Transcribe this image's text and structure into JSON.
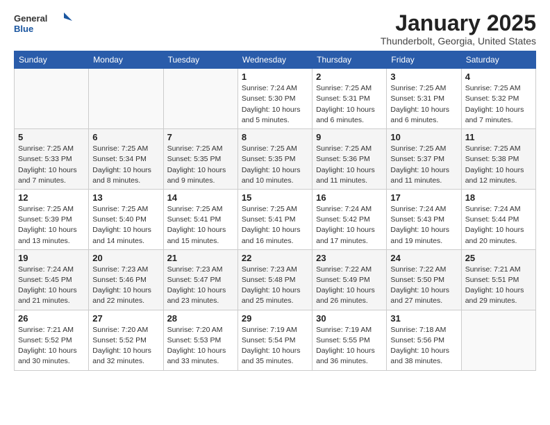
{
  "header": {
    "logo_general": "General",
    "logo_blue": "Blue",
    "month_title": "January 2025",
    "subtitle": "Thunderbolt, Georgia, United States"
  },
  "weekdays": [
    "Sunday",
    "Monday",
    "Tuesday",
    "Wednesday",
    "Thursday",
    "Friday",
    "Saturday"
  ],
  "weeks": [
    [
      {
        "day": "",
        "sunrise": "",
        "sunset": "",
        "daylight": ""
      },
      {
        "day": "",
        "sunrise": "",
        "sunset": "",
        "daylight": ""
      },
      {
        "day": "",
        "sunrise": "",
        "sunset": "",
        "daylight": ""
      },
      {
        "day": "1",
        "sunrise": "Sunrise: 7:24 AM",
        "sunset": "Sunset: 5:30 PM",
        "daylight": "Daylight: 10 hours and 5 minutes."
      },
      {
        "day": "2",
        "sunrise": "Sunrise: 7:25 AM",
        "sunset": "Sunset: 5:31 PM",
        "daylight": "Daylight: 10 hours and 6 minutes."
      },
      {
        "day": "3",
        "sunrise": "Sunrise: 7:25 AM",
        "sunset": "Sunset: 5:31 PM",
        "daylight": "Daylight: 10 hours and 6 minutes."
      },
      {
        "day": "4",
        "sunrise": "Sunrise: 7:25 AM",
        "sunset": "Sunset: 5:32 PM",
        "daylight": "Daylight: 10 hours and 7 minutes."
      }
    ],
    [
      {
        "day": "5",
        "sunrise": "Sunrise: 7:25 AM",
        "sunset": "Sunset: 5:33 PM",
        "daylight": "Daylight: 10 hours and 7 minutes."
      },
      {
        "day": "6",
        "sunrise": "Sunrise: 7:25 AM",
        "sunset": "Sunset: 5:34 PM",
        "daylight": "Daylight: 10 hours and 8 minutes."
      },
      {
        "day": "7",
        "sunrise": "Sunrise: 7:25 AM",
        "sunset": "Sunset: 5:35 PM",
        "daylight": "Daylight: 10 hours and 9 minutes."
      },
      {
        "day": "8",
        "sunrise": "Sunrise: 7:25 AM",
        "sunset": "Sunset: 5:35 PM",
        "daylight": "Daylight: 10 hours and 10 minutes."
      },
      {
        "day": "9",
        "sunrise": "Sunrise: 7:25 AM",
        "sunset": "Sunset: 5:36 PM",
        "daylight": "Daylight: 10 hours and 11 minutes."
      },
      {
        "day": "10",
        "sunrise": "Sunrise: 7:25 AM",
        "sunset": "Sunset: 5:37 PM",
        "daylight": "Daylight: 10 hours and 11 minutes."
      },
      {
        "day": "11",
        "sunrise": "Sunrise: 7:25 AM",
        "sunset": "Sunset: 5:38 PM",
        "daylight": "Daylight: 10 hours and 12 minutes."
      }
    ],
    [
      {
        "day": "12",
        "sunrise": "Sunrise: 7:25 AM",
        "sunset": "Sunset: 5:39 PM",
        "daylight": "Daylight: 10 hours and 13 minutes."
      },
      {
        "day": "13",
        "sunrise": "Sunrise: 7:25 AM",
        "sunset": "Sunset: 5:40 PM",
        "daylight": "Daylight: 10 hours and 14 minutes."
      },
      {
        "day": "14",
        "sunrise": "Sunrise: 7:25 AM",
        "sunset": "Sunset: 5:41 PM",
        "daylight": "Daylight: 10 hours and 15 minutes."
      },
      {
        "day": "15",
        "sunrise": "Sunrise: 7:25 AM",
        "sunset": "Sunset: 5:41 PM",
        "daylight": "Daylight: 10 hours and 16 minutes."
      },
      {
        "day": "16",
        "sunrise": "Sunrise: 7:24 AM",
        "sunset": "Sunset: 5:42 PM",
        "daylight": "Daylight: 10 hours and 17 minutes."
      },
      {
        "day": "17",
        "sunrise": "Sunrise: 7:24 AM",
        "sunset": "Sunset: 5:43 PM",
        "daylight": "Daylight: 10 hours and 19 minutes."
      },
      {
        "day": "18",
        "sunrise": "Sunrise: 7:24 AM",
        "sunset": "Sunset: 5:44 PM",
        "daylight": "Daylight: 10 hours and 20 minutes."
      }
    ],
    [
      {
        "day": "19",
        "sunrise": "Sunrise: 7:24 AM",
        "sunset": "Sunset: 5:45 PM",
        "daylight": "Daylight: 10 hours and 21 minutes."
      },
      {
        "day": "20",
        "sunrise": "Sunrise: 7:23 AM",
        "sunset": "Sunset: 5:46 PM",
        "daylight": "Daylight: 10 hours and 22 minutes."
      },
      {
        "day": "21",
        "sunrise": "Sunrise: 7:23 AM",
        "sunset": "Sunset: 5:47 PM",
        "daylight": "Daylight: 10 hours and 23 minutes."
      },
      {
        "day": "22",
        "sunrise": "Sunrise: 7:23 AM",
        "sunset": "Sunset: 5:48 PM",
        "daylight": "Daylight: 10 hours and 25 minutes."
      },
      {
        "day": "23",
        "sunrise": "Sunrise: 7:22 AM",
        "sunset": "Sunset: 5:49 PM",
        "daylight": "Daylight: 10 hours and 26 minutes."
      },
      {
        "day": "24",
        "sunrise": "Sunrise: 7:22 AM",
        "sunset": "Sunset: 5:50 PM",
        "daylight": "Daylight: 10 hours and 27 minutes."
      },
      {
        "day": "25",
        "sunrise": "Sunrise: 7:21 AM",
        "sunset": "Sunset: 5:51 PM",
        "daylight": "Daylight: 10 hours and 29 minutes."
      }
    ],
    [
      {
        "day": "26",
        "sunrise": "Sunrise: 7:21 AM",
        "sunset": "Sunset: 5:52 PM",
        "daylight": "Daylight: 10 hours and 30 minutes."
      },
      {
        "day": "27",
        "sunrise": "Sunrise: 7:20 AM",
        "sunset": "Sunset: 5:52 PM",
        "daylight": "Daylight: 10 hours and 32 minutes."
      },
      {
        "day": "28",
        "sunrise": "Sunrise: 7:20 AM",
        "sunset": "Sunset: 5:53 PM",
        "daylight": "Daylight: 10 hours and 33 minutes."
      },
      {
        "day": "29",
        "sunrise": "Sunrise: 7:19 AM",
        "sunset": "Sunset: 5:54 PM",
        "daylight": "Daylight: 10 hours and 35 minutes."
      },
      {
        "day": "30",
        "sunrise": "Sunrise: 7:19 AM",
        "sunset": "Sunset: 5:55 PM",
        "daylight": "Daylight: 10 hours and 36 minutes."
      },
      {
        "day": "31",
        "sunrise": "Sunrise: 7:18 AM",
        "sunset": "Sunset: 5:56 PM",
        "daylight": "Daylight: 10 hours and 38 minutes."
      },
      {
        "day": "",
        "sunrise": "",
        "sunset": "",
        "daylight": ""
      }
    ]
  ]
}
